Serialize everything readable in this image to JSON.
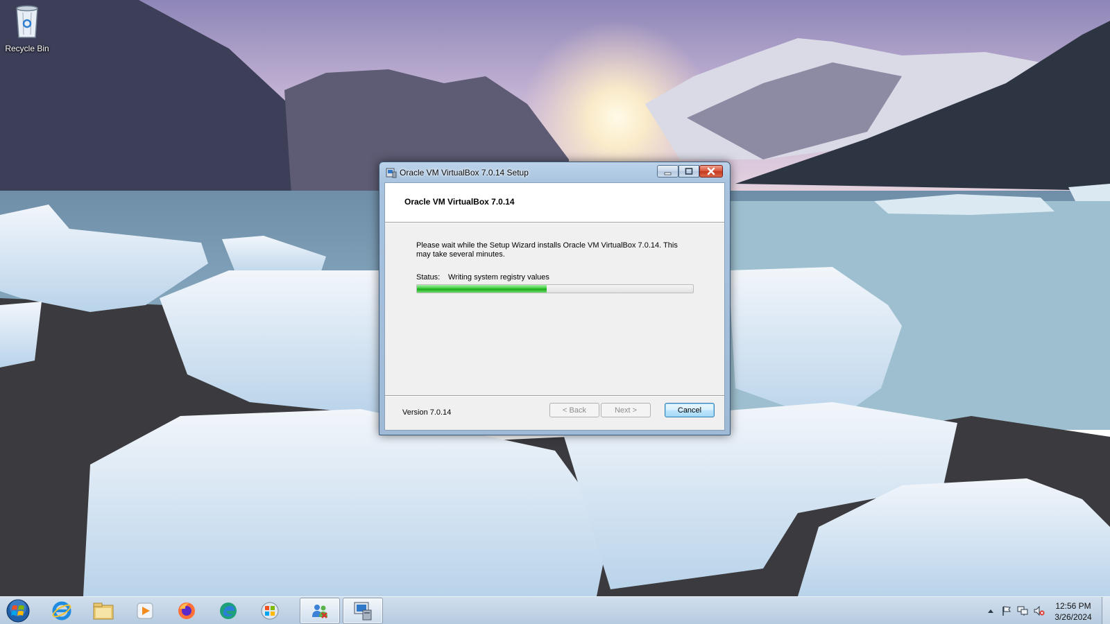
{
  "desktop": {
    "icons": [
      {
        "label": "Recycle Bin",
        "icon": "recycle-bin-icon"
      }
    ]
  },
  "window": {
    "title": "Oracle VM VirtualBox 7.0.14 Setup",
    "header_title": "Oracle VM VirtualBox 7.0.14",
    "description": "Please wait while the Setup Wizard installs Oracle VM VirtualBox 7.0.14. This may take several minutes.",
    "status_label": "Status:",
    "status_value": "Writing system registry values",
    "progress": 0.47,
    "version": "Version 7.0.14",
    "buttons": {
      "back": "< Back",
      "next": "Next >",
      "cancel": "Cancel"
    }
  },
  "taskbar": {
    "items": [
      {
        "icon": "start-orb-icon"
      },
      {
        "icon": "internet-explorer-icon"
      },
      {
        "icon": "file-explorer-icon"
      },
      {
        "icon": "media-player-icon"
      },
      {
        "icon": "firefox-icon"
      },
      {
        "icon": "edge-icon"
      },
      {
        "icon": "windows-logo-icon"
      },
      {
        "icon": "users-icon"
      },
      {
        "icon": "setup-installer-icon",
        "active": true
      }
    ],
    "tray": {
      "icons": [
        "show-hidden-icons-icon",
        "action-center-flag-icon",
        "network-icon",
        "volume-muted-icon"
      ],
      "time": "12:56 PM",
      "date": "3/26/2024"
    }
  },
  "colors": {
    "progress_green": "#19a919",
    "titlebar": "#bcd3ea",
    "close_red": "#c3371d"
  }
}
